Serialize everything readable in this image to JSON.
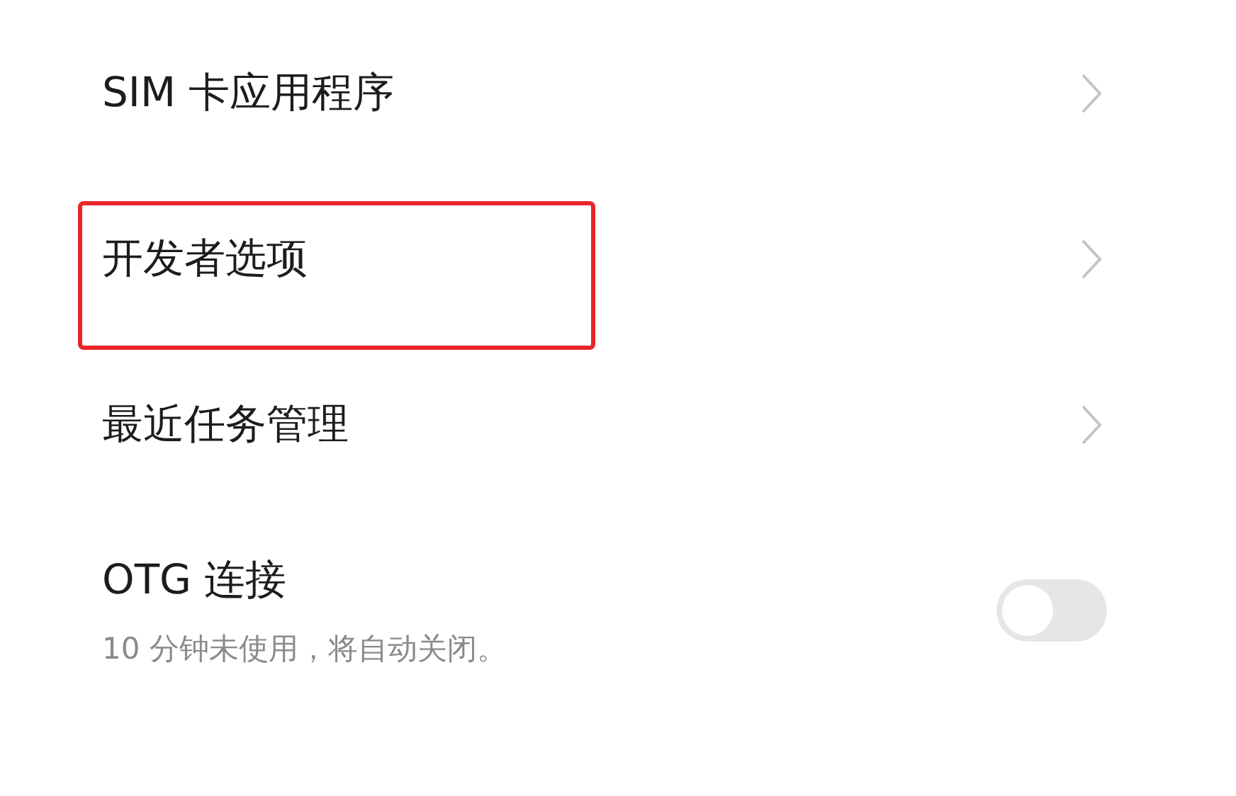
{
  "items": [
    {
      "kind": "link",
      "label": "SIM 卡应用程序",
      "highlighted": false
    },
    {
      "kind": "link",
      "label": "开发者选项",
      "highlighted": true
    },
    {
      "kind": "link",
      "label": "最近任务管理",
      "highlighted": false
    },
    {
      "kind": "toggle",
      "label": "OTG 连接",
      "description": "10 分钟未使用，将自动关闭。",
      "on": false,
      "highlighted": false
    }
  ]
}
